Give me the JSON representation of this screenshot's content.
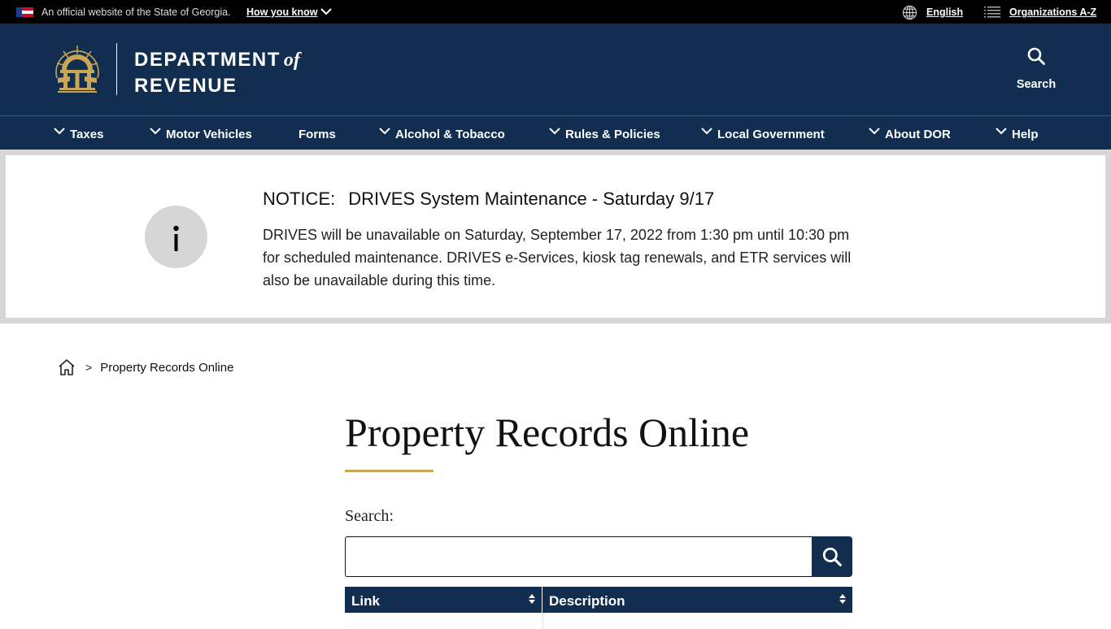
{
  "topbar": {
    "official_text": "An official website of the State of Georgia.",
    "how_you_know": "How you know",
    "language": "English",
    "organizations": "Organizations A-Z"
  },
  "header": {
    "brand_line1": "DEPARTMENT",
    "brand_of": "of",
    "brand_line2": "REVENUE",
    "search_label": "Search"
  },
  "nav": {
    "items": [
      {
        "label": "Taxes",
        "has_dropdown": true
      },
      {
        "label": "Motor Vehicles",
        "has_dropdown": true
      },
      {
        "label": "Forms",
        "has_dropdown": false
      },
      {
        "label": "Alcohol & Tobacco",
        "has_dropdown": true
      },
      {
        "label": "Rules & Policies",
        "has_dropdown": true
      },
      {
        "label": "Local Government",
        "has_dropdown": true
      },
      {
        "label": "About DOR",
        "has_dropdown": true
      },
      {
        "label": "Help",
        "has_dropdown": true
      }
    ]
  },
  "notice": {
    "label": "NOTICE:",
    "title": "DRIVES System Maintenance - Saturday 9/17",
    "body": "DRIVES will be unavailable on Saturday, September 17, 2022 from 1:30 pm until 10:30 pm for scheduled maintenance.  DRIVES e-Services, kiosk tag renewals, and ETR services will also be unavailable during this time."
  },
  "breadcrumb": {
    "separator": ">",
    "current": "Property Records Online"
  },
  "main": {
    "title": "Property Records Online",
    "search_label": "Search:",
    "search_value": "",
    "search_placeholder": ""
  },
  "table": {
    "columns": [
      "Link",
      "Description"
    ]
  },
  "colors": {
    "brand_navy": "#112e51",
    "accent_gold": "#c9a755",
    "notice_gray": "#d6d6d6"
  }
}
